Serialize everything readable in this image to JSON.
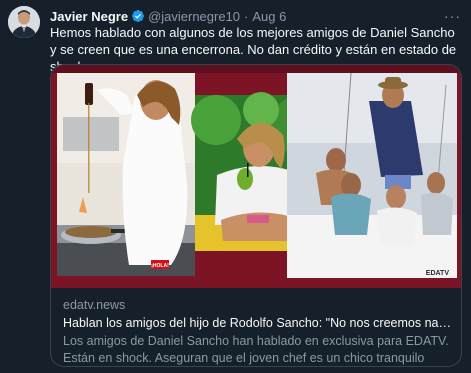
{
  "tweet": {
    "author_name": "Javier Negre",
    "handle": "@javiernegre10",
    "separator": "·",
    "date": "Aug 6",
    "more_label": "···",
    "text": "Hemos hablado con algunos de los mejores amigos de Daniel Sancho y se creen que es una encerrona. No dan crédito y están en estado de shock"
  },
  "card": {
    "domain": "edatv.news",
    "title": "Hablan los amigos del hijo de Rodolfo Sancho: \"No nos creemos nada...",
    "description": "Los amigos de Daniel Sancho han hablado en exclusiva para EDATV. Están en shock. Aseguran que el joven chef es un chico tranquilo",
    "image_badge": "¡HOLA!",
    "image_watermark": "EDATV"
  },
  "colors": {
    "background": "#15202b",
    "border": "#38444d",
    "secondary_text": "#8b98a5",
    "verified_blue": "#1d9bf0",
    "card_frame": "#7c1426"
  },
  "icons": {
    "verified": "verified-badge-icon",
    "more": "more-horizontal-icon"
  }
}
